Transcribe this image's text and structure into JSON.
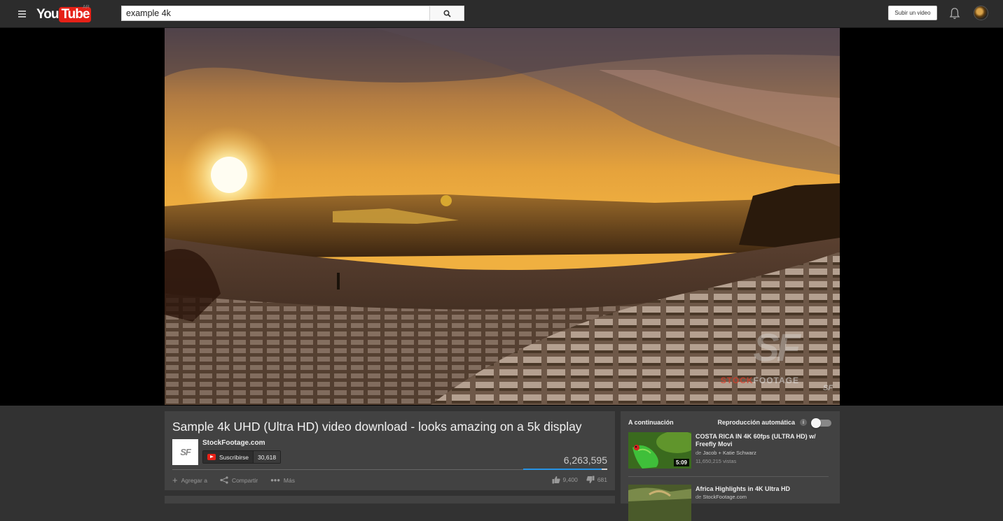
{
  "masthead": {
    "logo_you": "You",
    "logo_tube": "Tube",
    "region": "AR",
    "search_value": "example 4k",
    "upload_label": "Subir un video",
    "icons": [
      "menu-icon",
      "search-icon",
      "bell-icon",
      "avatar"
    ]
  },
  "player": {
    "watermark_stock": "STOCK",
    "watermark_footage": "FOOTAGE",
    "watermark_logo": "SF",
    "watermark_corner": "SF"
  },
  "video": {
    "title": "Sample 4k UHD (Ultra HD) video download - looks amazing on a 5k display",
    "channel": "StockFootage.com",
    "channel_thumb_text": "SF",
    "subscribe_label": "Suscribirse",
    "subscriber_count": "30,618",
    "views": "6,263,595",
    "like_fraction": 0.93,
    "actions": {
      "add_to": "Agregar a",
      "share": "Compartir",
      "more": "Más"
    },
    "likes": "9,400",
    "dislikes": "681"
  },
  "sidebar": {
    "up_next": "A continuación",
    "autoplay": "Reproducción automática",
    "info_icon": "i",
    "recs": [
      {
        "title": "COSTA RICA IN 4K 60fps (ULTRA HD) w/ Freefly Movi",
        "by_prefix": "de",
        "channel": "Jacob + Katie Schwarz",
        "views": "11,650,215 vistas",
        "duration": "5:09"
      },
      {
        "title": "Africa Highlights in 4K Ultra HD",
        "by_prefix": "de",
        "channel": "StockFootage.com"
      }
    ]
  },
  "colors": {
    "brand_red": "#e62117",
    "like_bar": "#2793e6",
    "panel": "#424242",
    "background": "#323232"
  }
}
